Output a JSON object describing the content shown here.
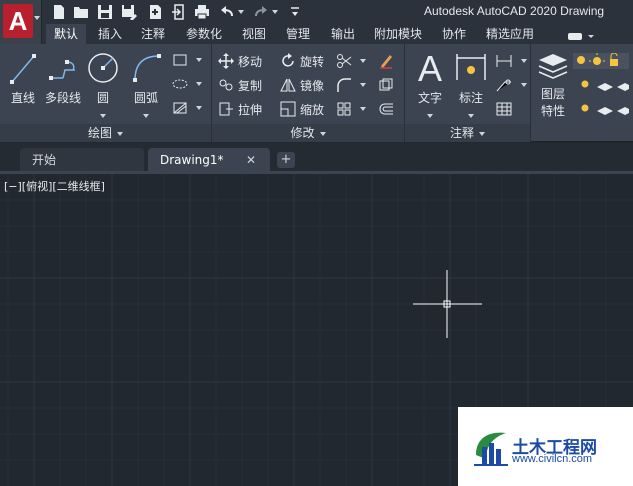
{
  "window": {
    "title": "Autodesk AutoCAD 2020   Drawing"
  },
  "app_button": {
    "letter": "A"
  },
  "quick_access": [
    "new-icon",
    "open-icon",
    "save-icon",
    "saveas-icon",
    "import-icon",
    "export-icon",
    "print-icon",
    "undo-icon",
    "redo-icon",
    "customize-icon"
  ],
  "ribbon_tabs": [
    {
      "label": "默认",
      "active": true
    },
    {
      "label": "插入"
    },
    {
      "label": "注释"
    },
    {
      "label": "参数化"
    },
    {
      "label": "视图"
    },
    {
      "label": "管理"
    },
    {
      "label": "输出"
    },
    {
      "label": "附加模块"
    },
    {
      "label": "协作"
    },
    {
      "label": "精选应用"
    }
  ],
  "panels": {
    "draw": {
      "title": "绘图",
      "line": "直线",
      "polyline": "多段线",
      "circle": "圆",
      "arc": "圆弧"
    },
    "modify": {
      "title": "修改",
      "move": "移动",
      "rotate": "旋转",
      "copy": "复制",
      "mirror": "镜像",
      "stretch": "拉伸",
      "scale": "缩放"
    },
    "annotation": {
      "title": "注释",
      "text": "文字",
      "dimension": "标注"
    },
    "layers": {
      "properties_line1": "图层",
      "properties_line2": "特性"
    }
  },
  "doc_tabs": [
    {
      "label": "开始"
    },
    {
      "label": "Drawing1*",
      "active": true
    }
  ],
  "viewport": {
    "label": "[−][俯视][二维线框]"
  },
  "watermark": {
    "title": "土木工程网",
    "url": "www.civilcn.com"
  },
  "colors": {
    "background": "#212830",
    "ribbon": "#3b4450",
    "accent_red": "#b8202d",
    "grid": "#2b3440"
  }
}
